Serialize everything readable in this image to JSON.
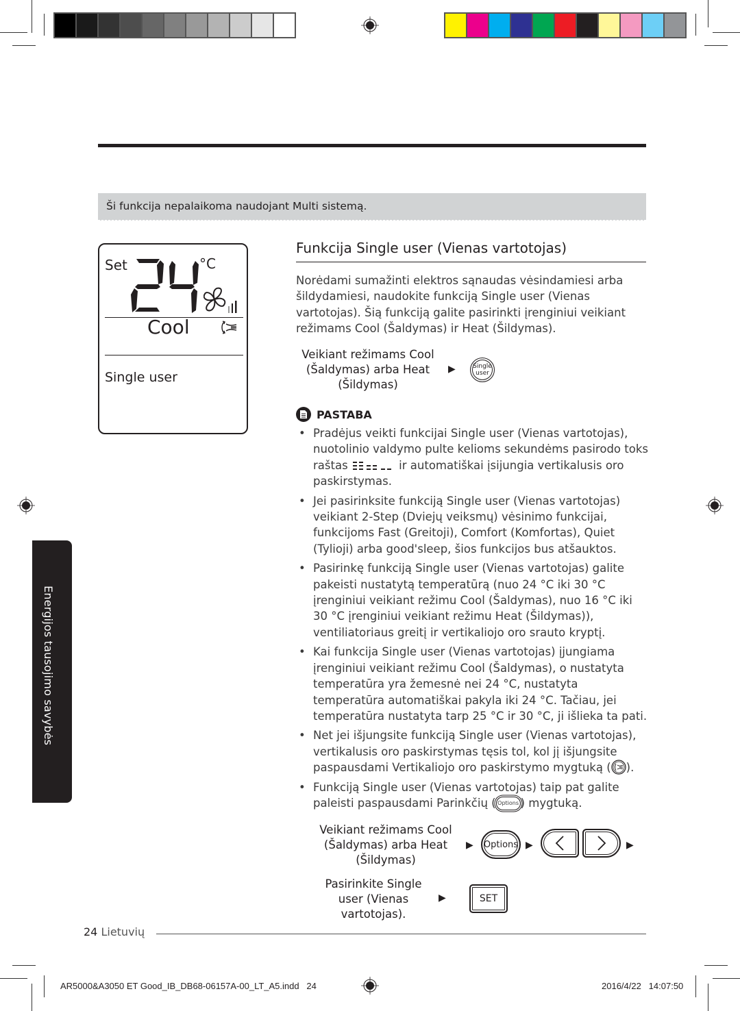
{
  "print_marks": {
    "grayscale_swatches": [
      "#000000",
      "#1a1a1a",
      "#333333",
      "#4d4d4d",
      "#666666",
      "#808080",
      "#999999",
      "#b3b3b3",
      "#cccccc",
      "#e6e6e6",
      "#ffffff"
    ],
    "color_swatches": [
      "#fff200",
      "#ec008c",
      "#00aeef",
      "#2e3192",
      "#00a651",
      "#ed1c24",
      "#231f20",
      "#fff799",
      "#f49ac1",
      "#6dcff6",
      "#939598"
    ]
  },
  "notice": "Ši funkcija nepalaikoma naudojant Multi sistemą.",
  "lcd": {
    "set_label": "Set",
    "temperature": "24",
    "unit": "°C",
    "mode": "Cool",
    "function": "Single user",
    "fan_level": 2
  },
  "section": {
    "title": "Funkcija Single user (Vienas vartotojas)",
    "intro": "Norėdami sumažinti elektros sąnaudas vėsindamiesi arba šildydamiesi, naudokite funkciją Single user (Vienas vartotojas). Šią funkciją galite pasirinkti įrenginiui veikiant režimams Cool (Šaldymas) ir Heat (Šildymas).",
    "step1": {
      "line1": "Veikiant režimams Cool",
      "line2": "(Šaldymas) arba Heat",
      "line3": "(Šildymas)",
      "button_line1": "Single",
      "button_line2": "user"
    },
    "note_heading": "PASTABA",
    "bullets": [
      {
        "before": "Pradėjus veikti funkcijai Single user (Vienas vartotojas), nuotolinio valdymo pulte kelioms sekundėms pasirodo toks raštas ",
        "pattern": "☷ ⚌ _ _",
        "after": " ir automatiškai įsijungia vertikalusis oro paskirstymas."
      },
      {
        "text": "Jei pasirinksite funkciją Single user (Vienas vartotojas) veikiant 2-Step (Dviejų veiksmų) vėsinimo funkcijai, funkcijoms Fast (Greitoji), Comfort (Komfortas), Quiet (Tylioji) arba good'sleep, šios funkcijos bus atšauktos."
      },
      {
        "text": "Pasirinkę funkciją Single user (Vienas vartotojas) galite pakeisti nustatytą temperatūrą (nuo 24 °C iki 30 °C įrenginiui veikiant režimu Cool (Šaldymas), nuo 16 °C iki 30 °C įrenginiui veikiant režimu Heat (Šildymas)), ventiliatoriaus greitį ir vertikaliojo oro srauto kryptį."
      },
      {
        "text": "Kai funkcija Single user (Vienas vartotojas) įjungiama įrenginiui veikiant režimu Cool (Šaldymas), o nustatyta temperatūra yra žemesnė nei 24 °C, nustatyta temperatūra automatiškai pakyla iki 24 °C. Tačiau, jei temperatūra nustatyta tarp 25 °C ir 30 °C, ji išlieka ta pati."
      },
      {
        "before": "Net jei išjungsite funkciją Single user (Vienas vartotojas), vertikalusis oro paskirstymas tęsis tol, kol jį išjungsite paspausdami Vertikaliojo oro paskirstymo mygtuką (",
        "after": ")."
      },
      {
        "before": "Funkciją Single user (Vienas vartotojas) taip pat galite paleisti paspausdami Parinkčių (",
        "inline_button": "Options",
        "after": ") mygtuką."
      }
    ],
    "step2": {
      "line1": "Veikiant režimams Cool",
      "line2": "(Šaldymas) arba Heat",
      "line3": "(Šildymas)",
      "options_label": "Options",
      "left_label": "<",
      "right_label": ">"
    },
    "step3": {
      "line1": "Pasirinkite Single",
      "line2": "user (Vienas",
      "line3": "vartotojas).",
      "set_label": "SET"
    }
  },
  "side_tab": "Energijos tausojimo savybės",
  "footer": {
    "page_number": "24",
    "language": "Lietuvių",
    "slug_file": "AR5000&A3050 ET Good_IB_DB68-06157A-00_LT_A5.indd   24",
    "slug_date": "2016/4/22   14:07:50"
  }
}
